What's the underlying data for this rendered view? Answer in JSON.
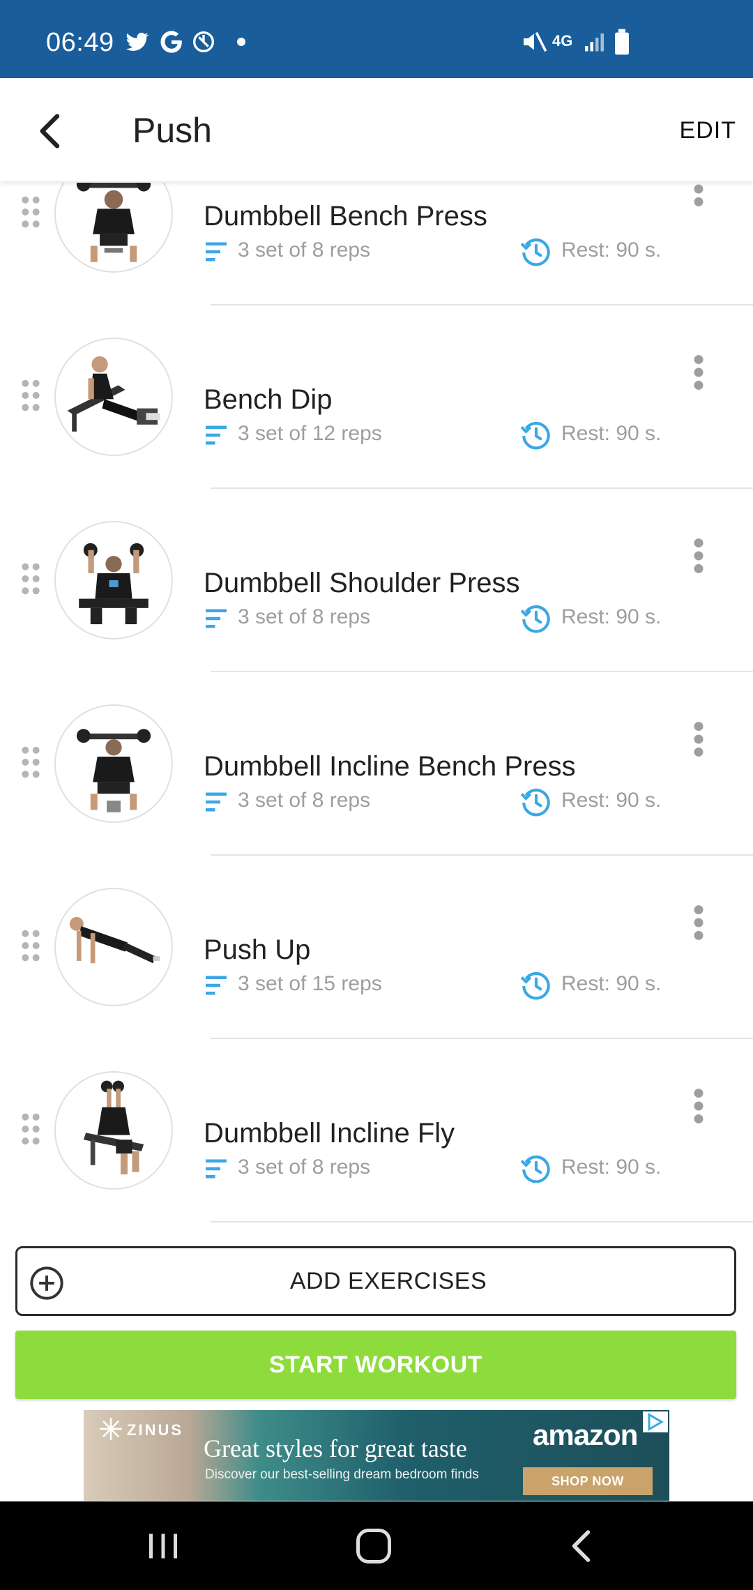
{
  "status_bar": {
    "time": "06:49",
    "icons": [
      "twitter-icon",
      "google-icon",
      "app-notification-icon",
      "dot-icon",
      "mute-icon",
      "4g-lte-icon",
      "signal-icon",
      "battery-icon"
    ],
    "network_label": "4G"
  },
  "app_bar": {
    "title": "Push",
    "edit_label": "EDIT",
    "back_icon": "chevron-left-icon"
  },
  "exercises": [
    {
      "name": "Dumbbell Bench Press",
      "sets": "3 set of 8 reps",
      "rest": "Rest: 90 s."
    },
    {
      "name": "Bench Dip",
      "sets": "3 set of 12 reps",
      "rest": "Rest: 90 s."
    },
    {
      "name": "Dumbbell Shoulder Press",
      "sets": "3 set of 8 reps",
      "rest": "Rest: 90 s."
    },
    {
      "name": "Dumbbell Incline Bench Press",
      "sets": "3 set of 8 reps",
      "rest": "Rest: 90 s."
    },
    {
      "name": "Push Up",
      "sets": "3 set of 15 reps",
      "rest": "Rest: 90 s."
    },
    {
      "name": "Dumbbell Incline Fly",
      "sets": "3 set of 8 reps",
      "rest": "Rest: 90 s."
    }
  ],
  "actions": {
    "add_label": "ADD EXERCISES",
    "start_label": "START WORKOUT"
  },
  "ad": {
    "brand": "ZINUS",
    "headline": "Great styles for great taste",
    "sub": "Discover our best-selling dream bedroom finds",
    "advertiser": "amazon",
    "cta": "SHOP NOW"
  },
  "colors": {
    "status_bar": "#1a5d9b",
    "accent_blue": "#3aa8e6",
    "start_green": "#8ddc3b",
    "meta_gray": "#9e9e9e"
  }
}
